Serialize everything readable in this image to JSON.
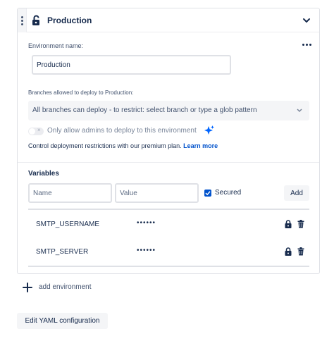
{
  "environment": {
    "title": "Production",
    "name_label": "Environment name:",
    "name_value": "Production",
    "branches_label": "Branches allowed to deploy to Production:",
    "branches_value": "All branches can deploy - to restrict: select branch or type a glob pattern",
    "admin_toggle_label": "Only allow admins to deploy to this environment",
    "admin_toggle_on": false,
    "premium_text": "Control deployment restrictions with our premium plan.",
    "learn_more": "Learn more"
  },
  "variables": {
    "title": "Variables",
    "name_placeholder": "Name",
    "value_placeholder": "Value",
    "secured_label": "Secured",
    "secured_checked": true,
    "add_label": "Add",
    "rows": [
      {
        "name": "SMTP_USERNAME",
        "value": "••••••"
      },
      {
        "name": "SMTP_SERVER",
        "value": "••••••"
      }
    ]
  },
  "add_environment": "add environment",
  "edit_yaml": "Edit YAML configuration",
  "colors": {
    "accent": "#0052cc",
    "sparkle": "#0065ff",
    "text": "#172b4d",
    "muted": "#7a869a"
  },
  "icons": [
    "drag-handle-icon",
    "unlock-icon",
    "chevron-down-icon",
    "more-icon",
    "sparkle-icon",
    "check-icon",
    "lock-icon",
    "trash-icon",
    "plus-icon"
  ]
}
